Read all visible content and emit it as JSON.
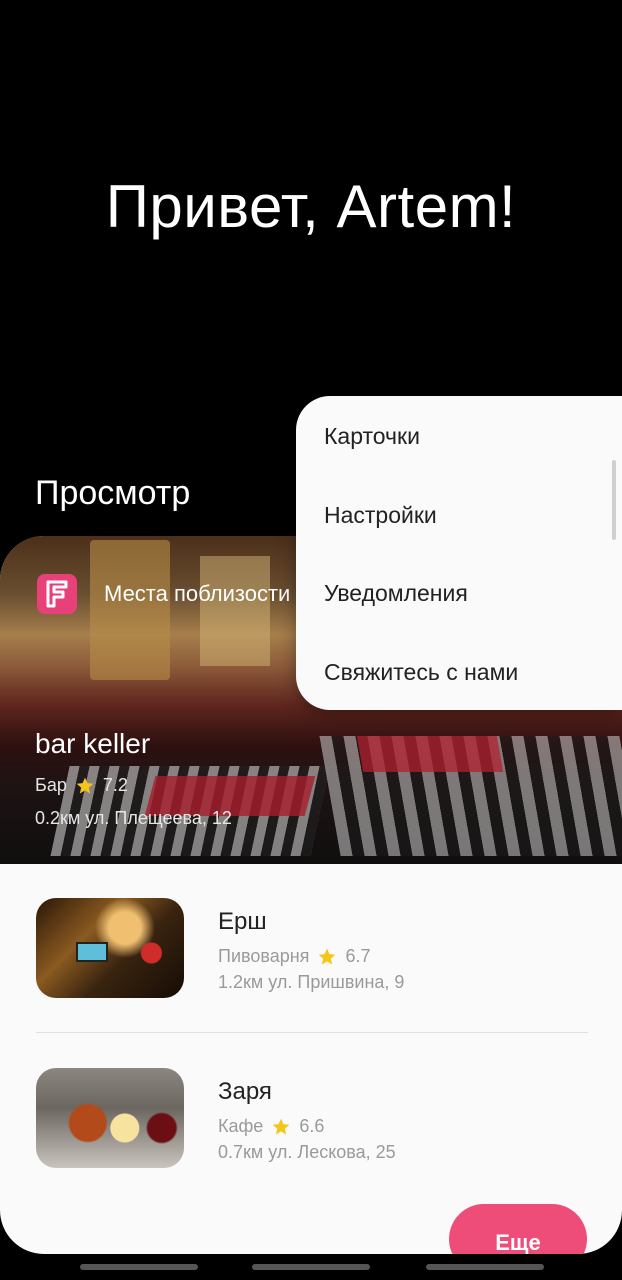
{
  "greeting": "Привет, Artem!",
  "section_title": "Просмотр",
  "card": {
    "source_label": "Места поблизости",
    "featured": {
      "name": "bar keller",
      "category": "Бар",
      "rating": "7.2",
      "address": "0.2км ул. Плещеева, 12"
    },
    "items": [
      {
        "name": "Ерш",
        "category": "Пивоварня",
        "rating": "6.7",
        "address": "1.2км ул. Пришвина, 9"
      },
      {
        "name": "Заря",
        "category": "Кафе",
        "rating": "6.6",
        "address": "0.7км ул. Лескова, 25"
      }
    ],
    "more_label": "Еще"
  },
  "menu": {
    "items": [
      "Карточки",
      "Настройки",
      "Уведомления",
      "Свяжитесь с нами"
    ]
  },
  "colors": {
    "accent": "#ee4d7a",
    "foursquare": "#e8417a",
    "star": "#f5c518"
  }
}
